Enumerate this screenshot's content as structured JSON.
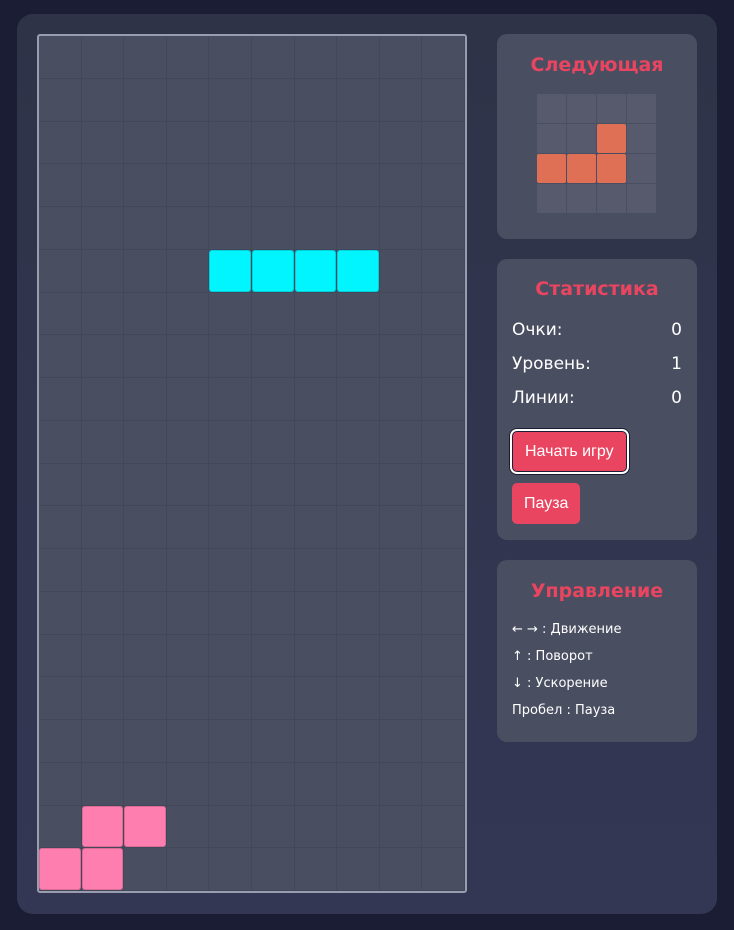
{
  "colors": {
    "accent": "#e94560",
    "board_bg": "#4a4e61",
    "piece_i": "#00f5ff",
    "piece_s": "#ff7eb0",
    "piece_next": "#e07055"
  },
  "board": {
    "columns": 10,
    "rows": 20,
    "active_piece": {
      "type": "I",
      "cells": [
        [
          4,
          5
        ],
        [
          5,
          5
        ],
        [
          6,
          5
        ],
        [
          7,
          5
        ]
      ]
    },
    "locked_cells": [
      [
        1,
        18
      ],
      [
        2,
        18
      ],
      [
        0,
        19
      ],
      [
        1,
        19
      ]
    ]
  },
  "next_panel": {
    "title": "Следующая",
    "grid_size": 4,
    "cells": [
      [
        2,
        1
      ],
      [
        0,
        2
      ],
      [
        1,
        2
      ],
      [
        2,
        2
      ]
    ]
  },
  "stats_panel": {
    "title": "Статистика",
    "score_label": "Очки:",
    "score_value": "0",
    "level_label": "Уровень:",
    "level_value": "1",
    "lines_label": "Линии:",
    "lines_value": "0",
    "start_button": "Начать игру",
    "pause_button": "Пауза"
  },
  "controls_panel": {
    "title": "Управление",
    "items": [
      "← → : Движение",
      "↑ : Поворот",
      "↓ : Ускорение",
      "Пробел : Пауза"
    ]
  }
}
